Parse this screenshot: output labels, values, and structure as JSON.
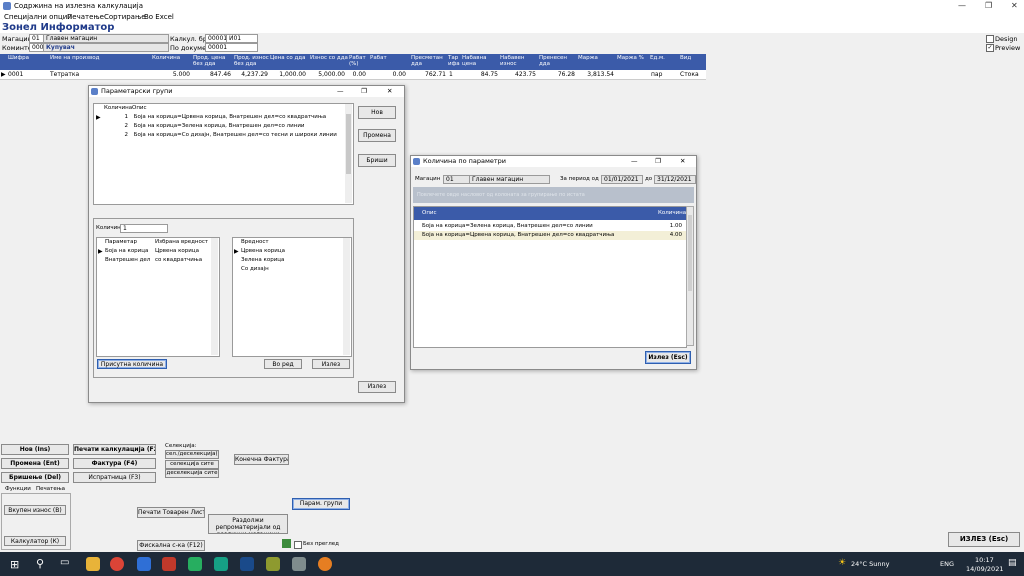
{
  "window": {
    "title": "Содржина на излезна калкулација",
    "min": "—",
    "max": "❐",
    "close": "✕"
  },
  "menu": [
    "Специјални опции",
    "Печатење",
    "Сортирање",
    "Во Excel"
  ],
  "app": {
    "title": "Зонел Информатор"
  },
  "header": {
    "warehouse_label": "Магацин",
    "warehouse_code": "01",
    "warehouse_name": "Главен магацин",
    "partner_label": "Коминтент",
    "partner_code": "0000",
    "partner_name": "Купувач",
    "calc_label": "Калкул. број",
    "calc_no": "00001",
    "calc_suffix": "И01",
    "doc_label": "По документ",
    "doc_no": "00001",
    "design_label": "Design",
    "preview_label": "Preview"
  },
  "main_grid": {
    "columns": [
      "Шифра",
      "Име на производ",
      "Количина",
      "Прод. цена без дда",
      "Прод. износ без дда",
      "Цена со дда",
      "Износ со дда",
      "Рабат (%)",
      "Рабат",
      "Пресметан дда",
      "Тар ифа",
      "Набавна цена",
      "Набавен износ",
      "Пренесен дда",
      "Маржа",
      "Маржа %",
      "Ед.м.",
      "",
      "Вид"
    ],
    "row": [
      "0001",
      "Тетратка",
      "5.000",
      "847.46",
      "4,237.29",
      "1,000.00",
      "5,000.00",
      "0.00",
      "0.00",
      "762.71",
      "1",
      "84.75",
      "423.75",
      "76.28",
      "3,813.54",
      "",
      "пар",
      "",
      "Стока"
    ]
  },
  "param_dialog": {
    "title": "Параметарски групи",
    "list_headers": [
      "Количина",
      "Опис"
    ],
    "list_rows": [
      {
        "qty": "1",
        "desc": "Боја на корица=Црвена корица, Внатрешен дел=со квадратчиња"
      },
      {
        "qty": "2",
        "desc": "Боја на корица=Зелена корица, Внатрешен дел=со линии"
      },
      {
        "qty": "2",
        "desc": "Боја на корица=Со дизајн, Внатрешен дел=со тесни и широки линии"
      }
    ],
    "btn_new": "Нов",
    "btn_edit": "Промена",
    "btn_delete": "Бриши",
    "qty_label": "Количина",
    "qty_value": "1",
    "param_headers": [
      "Параметар",
      "Избрана вредност"
    ],
    "param_rows": [
      {
        "name": "Боја на корица",
        "value": "Црвена корица"
      },
      {
        "name": "Внатрешен дел",
        "value": "со квадратчиња"
      }
    ],
    "values_header": "Вредност",
    "values": [
      "Црвена корица",
      "Зелена корица",
      "Со дизајн"
    ],
    "btn_assign": "Присутна количина",
    "btn_inorder": "Во ред",
    "btn_exit_inner": "Излез",
    "btn_exit": "Излез"
  },
  "qty_dialog": {
    "title": "Количина по параметри",
    "warehouse_label": "Магацин",
    "warehouse_code": "01",
    "warehouse_name": "Главен магацин",
    "period_label": "За период од",
    "date_from": "01/01/2021",
    "to_label": "до",
    "date_to": "31/12/2021",
    "group_hint": "Повлечете овде насловот од колоната за групирање по истата",
    "headers": [
      "Опис",
      "Количина"
    ],
    "rows": [
      {
        "desc": "Боја на корица=Зелена корица, Внатрешен дел=со линии",
        "qty": "1.00"
      },
      {
        "desc": "Боја на корица=Црвена корица, Внатрешен дел=со квадратчиња",
        "qty": "4.00"
      }
    ],
    "btn_exit": "Излез (Esc)"
  },
  "bottom": {
    "btn_new": "Нов (Ins)",
    "btn_edit": "Промена (Ent)",
    "btn_delete": "Бришење (Del)",
    "tab_functions": "Функции",
    "tab_print": "Печатења",
    "btn_total": "Вкупен износ (В)",
    "btn_calc": "Калкулатор (К)",
    "btn_print_calc": "Печати калкулација (F2)",
    "btn_invoice": "Фактура (F4)",
    "btn_dispatch": "Испратница (F3)",
    "selection_label": "Селекција:",
    "sel_1": "сел./деселекција(*)",
    "sel_2": "селекција сите",
    "sel_3": "деселекција сите",
    "btn_final_invoice": "Конечна Фактура",
    "btn_param_groups": "Парам. групи",
    "btn_print_list": "Печати Товарен Лист",
    "btn_split": "Раздолжи репроматеријали од различни магацини",
    "btn_fiscal": "Фискална с-ка (F12)",
    "no_preview": "Без преглед",
    "btn_exit": "ИЗЛЕЗ (Esc)"
  },
  "taskbar": {
    "weather": "24°C  Sunny",
    "lang": "ENG",
    "time": "10:17",
    "date": "14/09/2021"
  }
}
